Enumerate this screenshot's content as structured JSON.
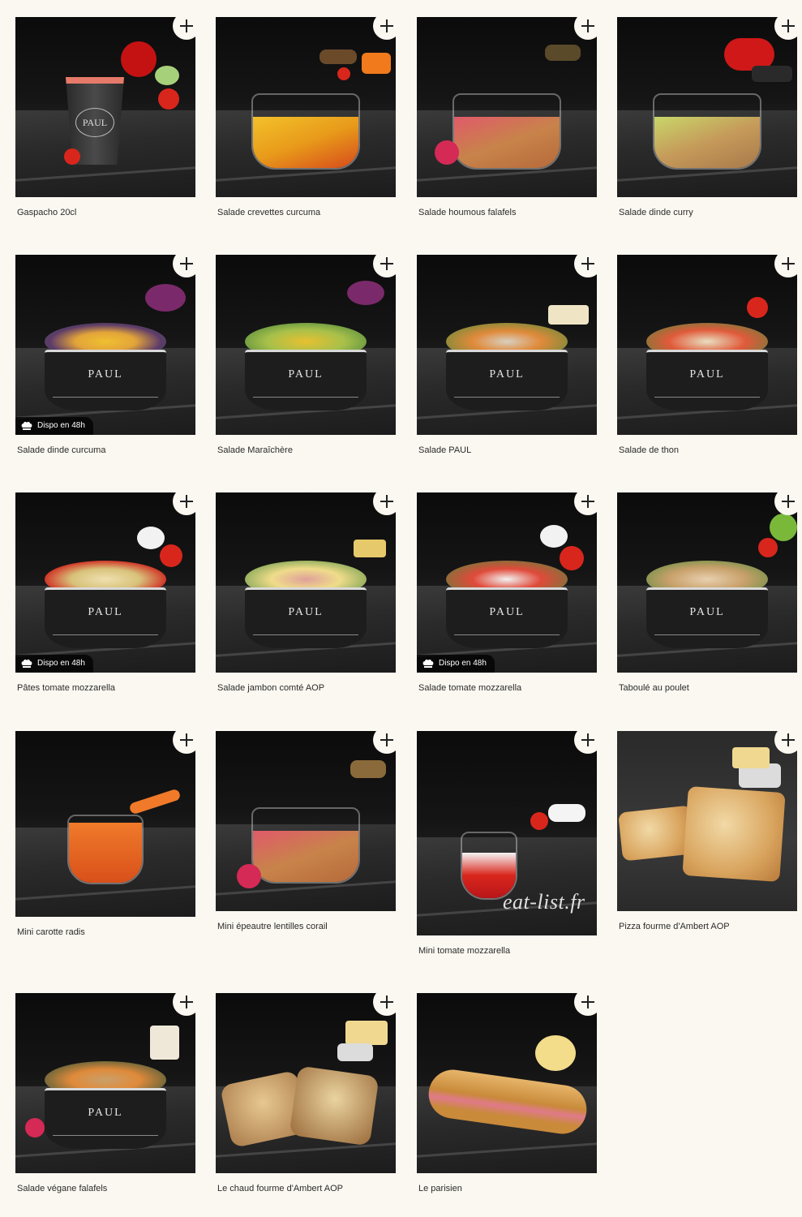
{
  "badge_text": "Dispo en 48h",
  "brand_on_pack": "PAUL",
  "watermark": "eat-list.fr",
  "products": [
    {
      "name": "Gaspacho 20cl"
    },
    {
      "name": "Salade crevettes curcuma"
    },
    {
      "name": "Salade houmous falafels"
    },
    {
      "name": "Salade dinde curry"
    },
    {
      "name": "Salade dinde curcuma",
      "badge": true
    },
    {
      "name": "Salade Maraîchère"
    },
    {
      "name": "Salade PAUL"
    },
    {
      "name": "Salade de thon"
    },
    {
      "name": "Pâtes tomate mozzarella",
      "badge": true
    },
    {
      "name": "Salade jambon comté AOP"
    },
    {
      "name": "Salade tomate mozzarella",
      "badge": true
    },
    {
      "name": "Taboulé au poulet"
    },
    {
      "name": "Mini carotte radis"
    },
    {
      "name": "Mini épeautre lentilles corail"
    },
    {
      "name": "Mini tomate mozzarella"
    },
    {
      "name": "Pizza fourme d'Ambert AOP"
    },
    {
      "name": "Salade végane falafels"
    },
    {
      "name": "Le chaud fourme d'Ambert AOP"
    },
    {
      "name": "Le parisien"
    }
  ]
}
